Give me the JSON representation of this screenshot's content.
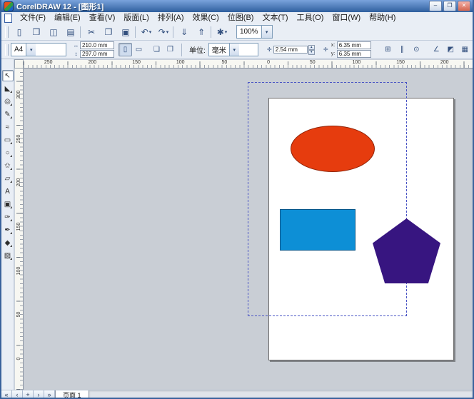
{
  "titlebar": {
    "title": "CorelDRAW 12 - [图形1]",
    "buttons": [
      {
        "name": "minimize",
        "glyph": "–"
      },
      {
        "name": "maximize",
        "glyph": "❐"
      },
      {
        "name": "close",
        "glyph": "✕"
      }
    ]
  },
  "menubar": {
    "items": [
      "文件(F)",
      "编辑(E)",
      "查看(V)",
      "版面(L)",
      "排列(A)",
      "效果(C)",
      "位图(B)",
      "文本(T)",
      "工具(O)",
      "窗口(W)",
      "帮助(H)"
    ]
  },
  "toolbar": {
    "buttons": [
      {
        "name": "new-document",
        "glyph": "▯"
      },
      {
        "name": "open-document",
        "glyph": "❒"
      },
      {
        "name": "save-document",
        "glyph": "◫"
      },
      {
        "name": "print",
        "glyph": "▤",
        "sep_after": true
      },
      {
        "name": "cut",
        "glyph": "✂"
      },
      {
        "name": "copy",
        "glyph": "❐"
      },
      {
        "name": "paste",
        "glyph": "▣",
        "sep_after": true
      },
      {
        "name": "undo",
        "glyph": "↶",
        "dropdown": true
      },
      {
        "name": "redo",
        "glyph": "↷",
        "dropdown": true,
        "sep_after": true
      },
      {
        "name": "import",
        "glyph": "⇓"
      },
      {
        "name": "export",
        "glyph": "⇑",
        "sep_after": true
      },
      {
        "name": "application-launcher",
        "glyph": "✱",
        "dropdown": true
      }
    ],
    "zoom_label": "100%"
  },
  "property_bar": {
    "paper_type": "A4",
    "paper_width": "210.0 mm",
    "paper_height": "297.0 mm",
    "portrait_glyph": "▯",
    "landscape_glyph": "▭",
    "page_buttons": [
      {
        "name": "set-default-all-pages",
        "glyph": "❏"
      },
      {
        "name": "set-default-current-page",
        "glyph": "❐"
      }
    ],
    "units_label": "单位:",
    "units_value": "毫米",
    "nudge_icon_glyph": "✛",
    "nudge_value": "2.54 mm",
    "duplicate_x_label": "x:",
    "duplicate_x_value": "6.35 mm",
    "duplicate_y_label": "y:",
    "duplicate_y_value": "6.35 mm",
    "right_buttons": [
      {
        "name": "snap-to-grid",
        "glyph": "⊞"
      },
      {
        "name": "snap-to-guidelines",
        "glyph": "∥"
      },
      {
        "name": "snap-to-objects",
        "glyph": "⊙"
      },
      {
        "name": "dynamic-guides",
        "glyph": "∠",
        "gap_before": true
      },
      {
        "name": "treat-as-filled",
        "glyph": "◩"
      },
      {
        "name": "draw-complex-objects",
        "glyph": "▦"
      }
    ]
  },
  "rulers": {
    "horizontal_labels": [
      "250",
      "200",
      "150",
      "100",
      "50",
      "0",
      "50",
      "100",
      "150",
      "200"
    ],
    "vertical_labels": [
      "300",
      "250",
      "200",
      "150",
      "100",
      "50",
      "0"
    ]
  },
  "toolbox": {
    "tools": [
      {
        "name": "pick-tool",
        "glyph": "↖",
        "active": true
      },
      {
        "name": "shape-tool",
        "glyph": "◣",
        "flyout": true
      },
      {
        "name": "zoom-tool",
        "glyph": "◎",
        "flyout": true
      },
      {
        "name": "freehand-tool",
        "glyph": "✎",
        "flyout": true
      },
      {
        "name": "smart-drawing-tool",
        "glyph": "≈"
      },
      {
        "name": "rectangle-tool",
        "glyph": "▭",
        "flyout": true
      },
      {
        "name": "ellipse-tool",
        "glyph": "○",
        "flyout": true
      },
      {
        "name": "polygon-tool",
        "glyph": "✩",
        "flyout": true
      },
      {
        "name": "basic-shapes-tool",
        "glyph": "▱",
        "flyout": true
      },
      {
        "name": "text-tool",
        "glyph": "A"
      },
      {
        "name": "interactive-blend-tool",
        "glyph": "▣",
        "flyout": true
      },
      {
        "name": "eyedropper-tool",
        "glyph": "✑",
        "flyout": true
      },
      {
        "name": "outline-tool",
        "glyph": "✒",
        "flyout": true
      },
      {
        "name": "fill-tool",
        "glyph": "◆",
        "flyout": true
      },
      {
        "name": "interactive-fill-tool",
        "glyph": "▨",
        "flyout": true
      }
    ]
  },
  "canvas": {
    "shapes": {
      "ellipse_fill": "#e63c0e",
      "rectangle_fill": "#0d8fd6",
      "pentagon_fill": "#371580"
    }
  },
  "page_bar": {
    "nav_buttons": [
      {
        "name": "first-page",
        "glyph": "«"
      },
      {
        "name": "prev-page",
        "glyph": "‹"
      },
      {
        "name": "add-page",
        "glyph": "+"
      },
      {
        "name": "next-page",
        "glyph": "›"
      },
      {
        "name": "last-page",
        "glyph": "»"
      }
    ],
    "tab_label": "页面 1"
  },
  "icons": {
    "combo_arrow": "▾",
    "spin_up": "▴",
    "spin_down": "▾"
  }
}
